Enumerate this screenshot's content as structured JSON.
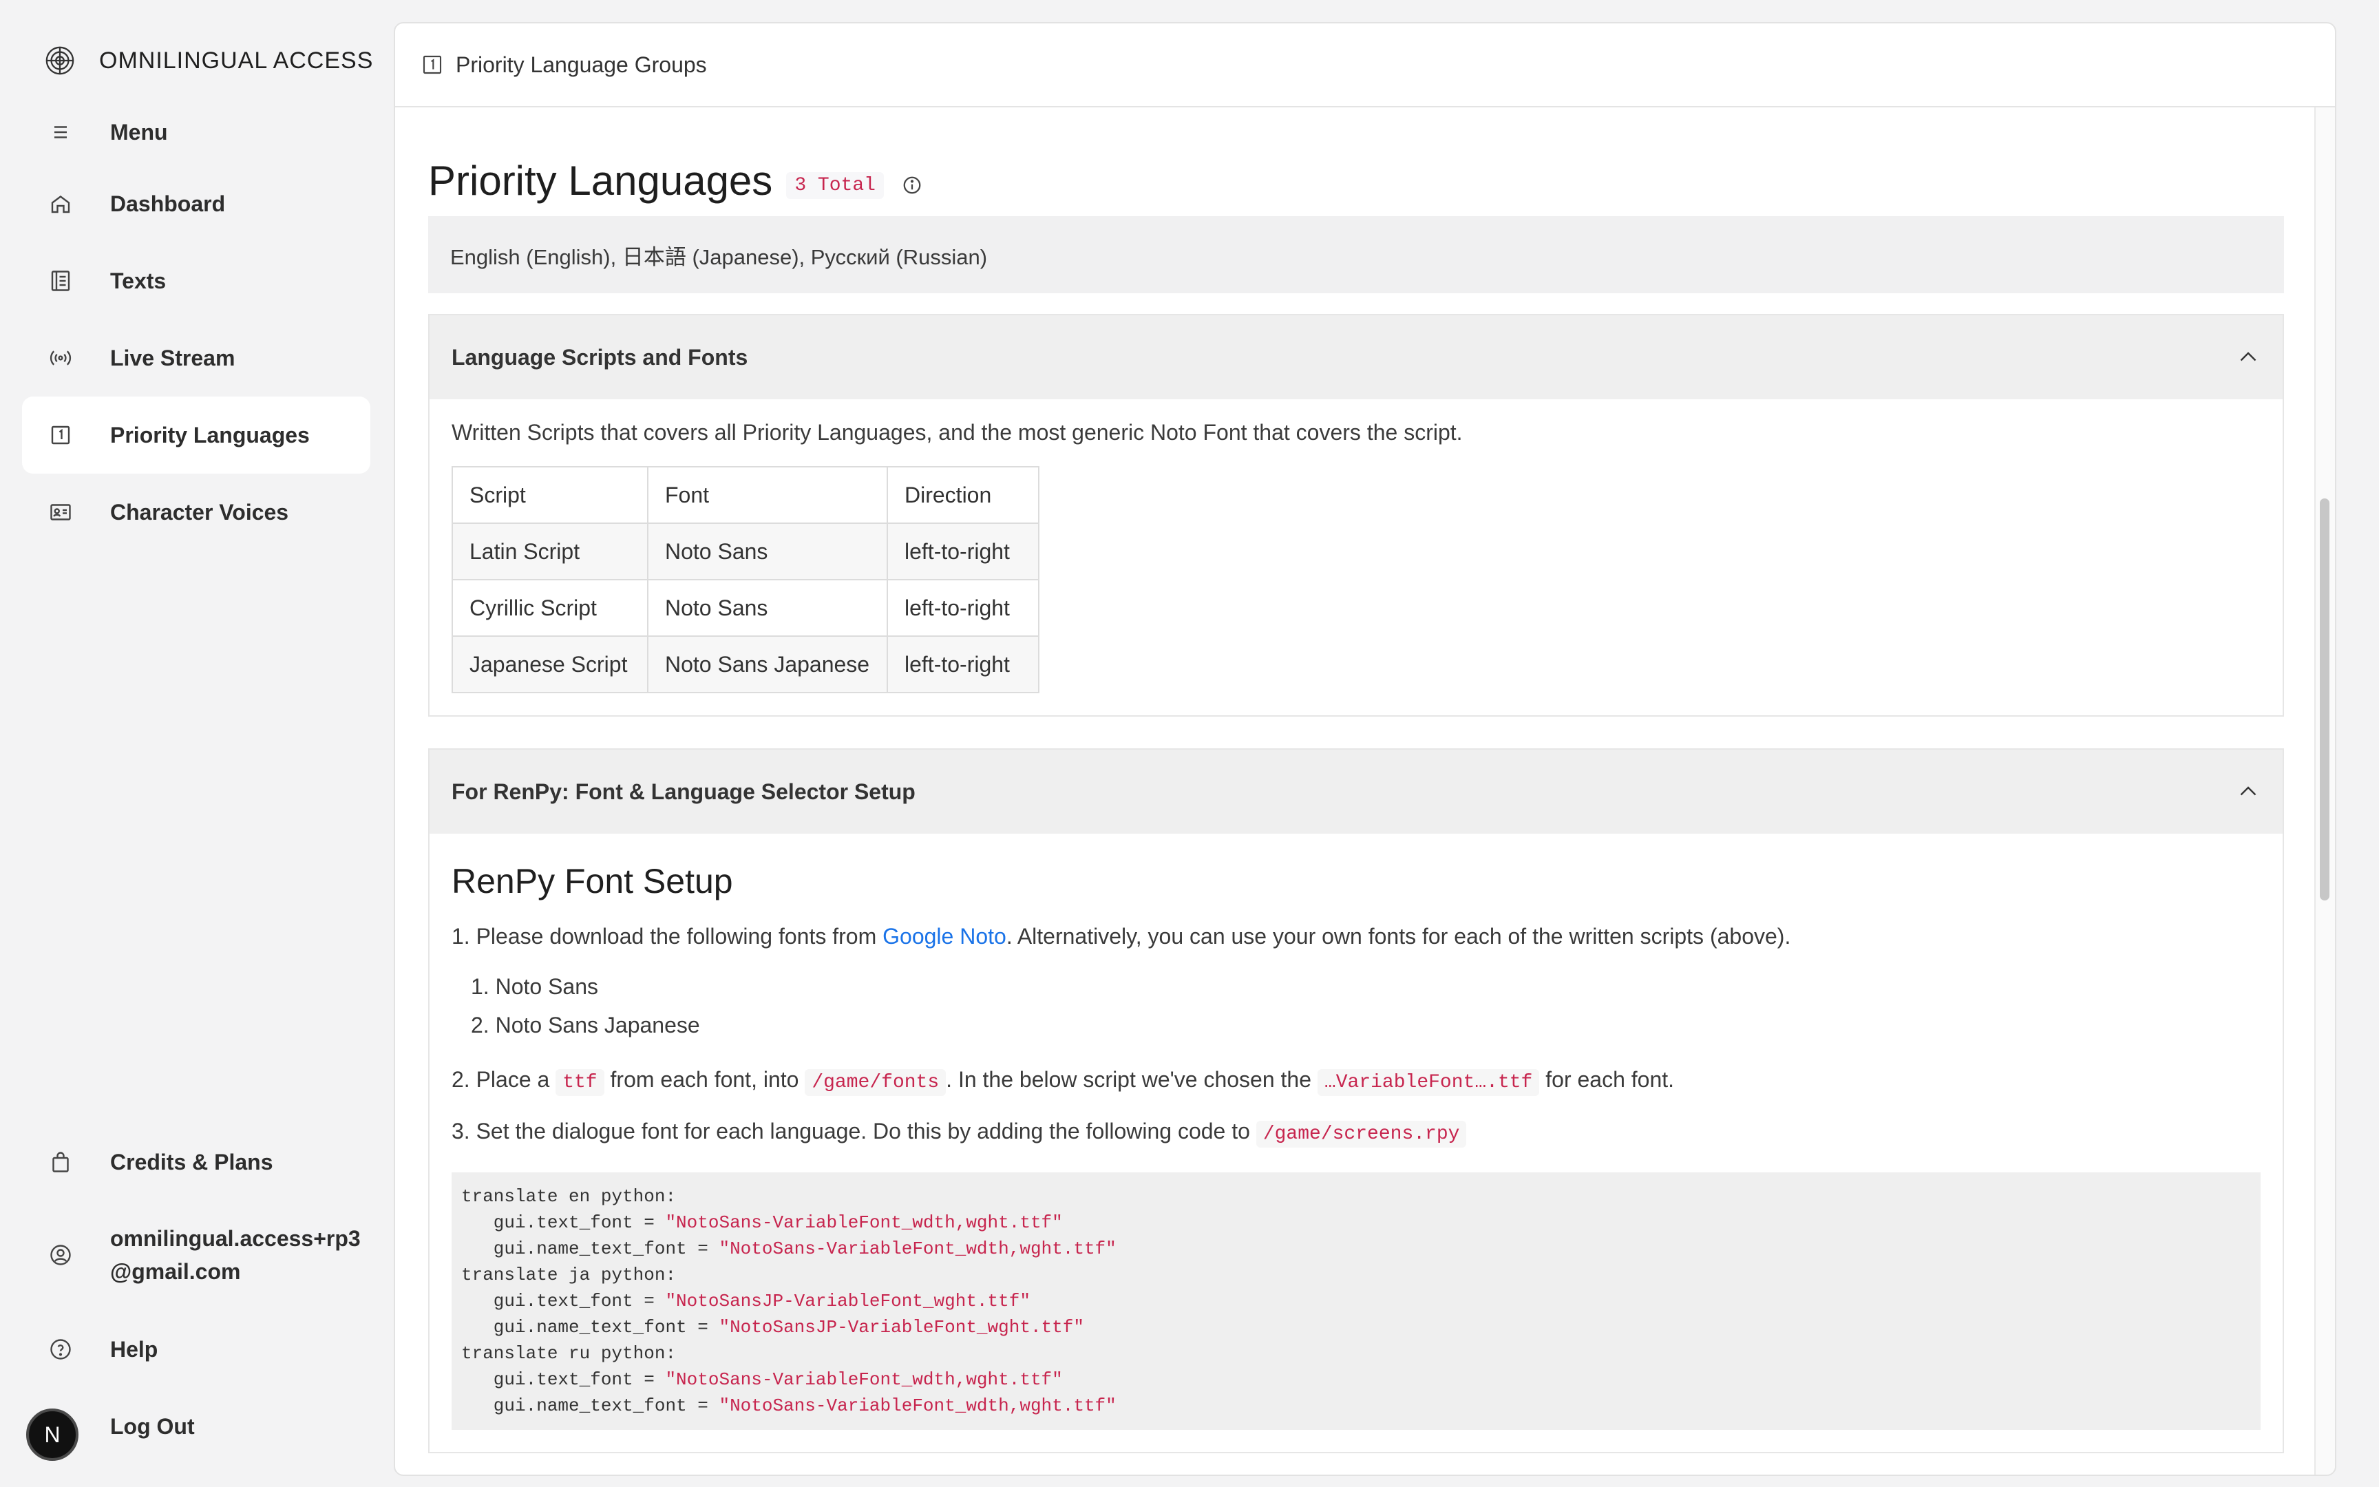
{
  "app": {
    "name": "OMNILINGUAL ACCESS"
  },
  "sidebar": {
    "items": [
      {
        "label": "Menu",
        "icon": "hamburger-icon"
      },
      {
        "label": "Dashboard",
        "icon": "home-icon"
      },
      {
        "label": "Texts",
        "icon": "document-list-icon"
      },
      {
        "label": "Live Stream",
        "icon": "broadcast-icon"
      },
      {
        "label": "Priority Languages",
        "icon": "number-one-icon",
        "active": true
      },
      {
        "label": "Character Voices",
        "icon": "id-card-icon"
      }
    ],
    "bottom": [
      {
        "label": "Credits & Plans",
        "icon": "shopping-bag-icon"
      },
      {
        "label_line1": "omnilingual.access+rp3",
        "label_line2": "@gmail.com",
        "icon": "user-circle-icon"
      },
      {
        "label": "Help",
        "icon": "help-circle-icon"
      },
      {
        "label": "Log Out",
        "icon": "logout-icon"
      }
    ],
    "avatar_letter": "N"
  },
  "topbar": {
    "title": "Priority Language Groups"
  },
  "page": {
    "title": "Priority Languages",
    "badge": "3 Total",
    "languages_summary": "English (English), 日本語 (Japanese), Русский (Russian)"
  },
  "scripts_section": {
    "heading": "Language Scripts and Fonts",
    "description": "Written Scripts that covers all Priority Languages, and the most generic Noto Font that covers the script.",
    "columns": [
      "Script",
      "Font",
      "Direction"
    ],
    "rows": [
      [
        "Latin Script",
        "Noto Sans",
        "left-to-right"
      ],
      [
        "Cyrillic Script",
        "Noto Sans",
        "left-to-right"
      ],
      [
        "Japanese Script",
        "Noto Sans Japanese",
        "left-to-right"
      ]
    ]
  },
  "renpy_section": {
    "heading": "For RenPy: Font & Language Selector Setup",
    "title": "RenPy Font Setup",
    "step1_prefix": "1. Please download the following fonts from ",
    "step1_link": "Google Noto",
    "step1_suffix": ". Alternatively, you can use your own fonts for each of the written scripts (above).",
    "fonts": [
      "1. Noto Sans",
      "2. Noto Sans Japanese"
    ],
    "step2_a": "2. Place a ",
    "step2_code1": "ttf",
    "step2_b": " from each font, into ",
    "step2_code2": "/game/fonts",
    "step2_c": ". In the below script we've chosen the ",
    "step2_code3": "…VariableFont….ttf",
    "step2_d": " for each font.",
    "step3_a": "3. Set the dialogue font for each language. Do this by adding the following code to ",
    "step3_code": "/game/screens.rpy",
    "code_lines": [
      {
        "text": "translate en python:"
      },
      {
        "prefix": "   gui.text_font = ",
        "str": "\"NotoSans-VariableFont_wdth,wght.ttf\""
      },
      {
        "prefix": "   gui.name_text_font = ",
        "str": "\"NotoSans-VariableFont_wdth,wght.ttf\""
      },
      {
        "text": "translate ja python:"
      },
      {
        "prefix": "   gui.text_font = ",
        "str": "\"NotoSansJP-VariableFont_wght.ttf\""
      },
      {
        "prefix": "   gui.name_text_font = ",
        "str": "\"NotoSansJP-VariableFont_wght.ttf\""
      },
      {
        "text": "translate ru python:"
      },
      {
        "prefix": "   gui.text_font = ",
        "str": "\"NotoSans-VariableFont_wdth,wght.ttf\""
      },
      {
        "prefix": "   gui.name_text_font = ",
        "str": "\"NotoSans-VariableFont_wdth,wght.ttf\""
      }
    ]
  },
  "colors": {
    "background": "#f3f3f4",
    "panel": "#ffffff",
    "code_red": "#c7254e",
    "link_blue": "#1a73e8"
  }
}
